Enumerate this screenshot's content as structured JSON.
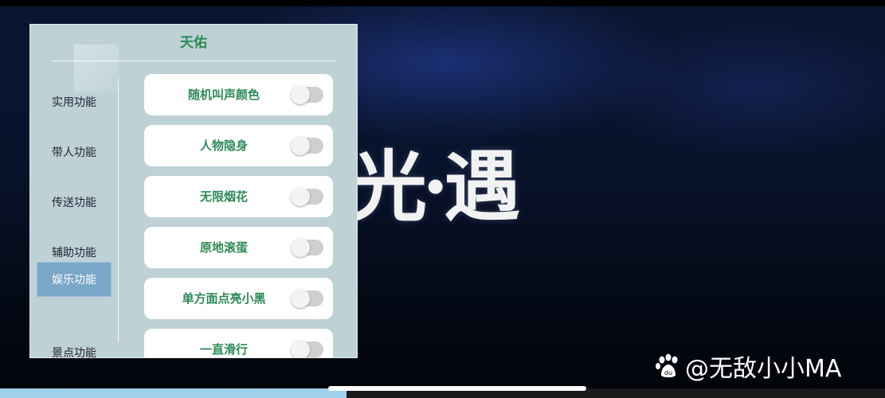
{
  "panel": {
    "title": "天佑",
    "sidebar_items": [
      {
        "label": "实用功能",
        "active": false
      },
      {
        "label": "带人功能",
        "active": false
      },
      {
        "label": "传送功能",
        "active": false
      },
      {
        "label": "辅助功能",
        "active": false
      },
      {
        "label": "娱乐功能",
        "active": true
      },
      {
        "label": "景点功能",
        "active": false
      }
    ],
    "toggles": [
      {
        "label": "随机叫声颜色",
        "on": false
      },
      {
        "label": "人物隐身",
        "on": false
      },
      {
        "label": "无限烟花",
        "on": false
      },
      {
        "label": "原地滚蛋",
        "on": false
      },
      {
        "label": "单方面点亮小黑",
        "on": false
      },
      {
        "label": "一直滑行",
        "on": false
      }
    ]
  },
  "background": {
    "game_logo": "光·遇"
  },
  "watermark": {
    "text": "@无敌小小MA",
    "icon": "baidu-paw-icon"
  },
  "colors": {
    "panel_bg": "#bed2d6",
    "accent_green": "#2e8b57",
    "active_tab": "#7aa7c7",
    "progress": "#9fd0ec"
  }
}
